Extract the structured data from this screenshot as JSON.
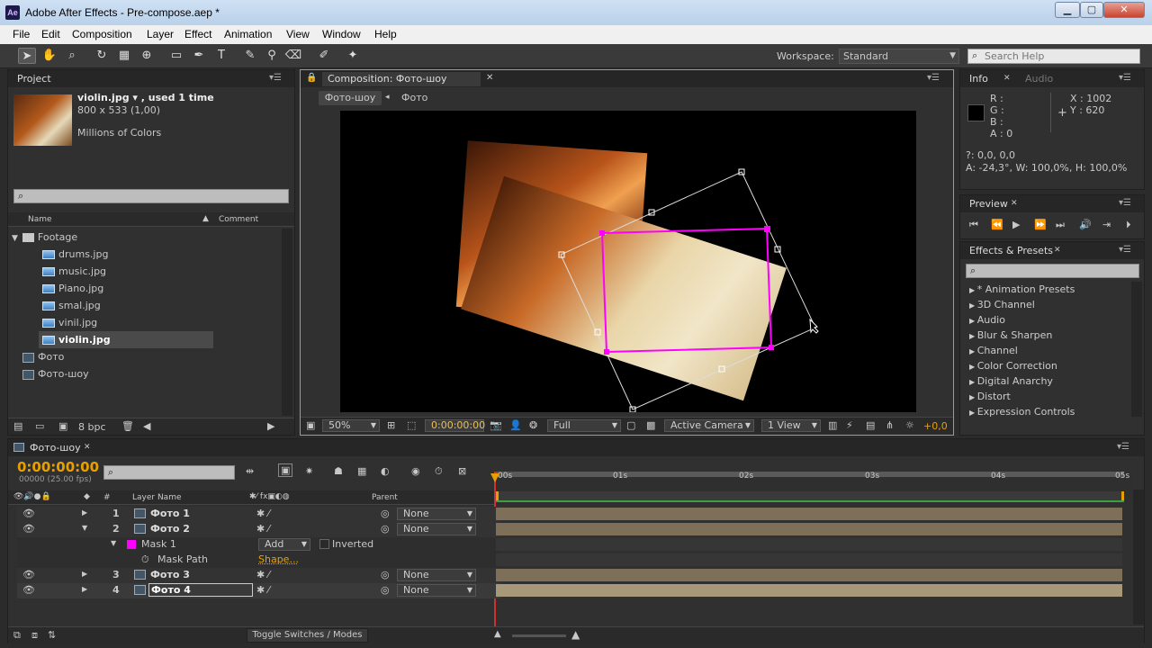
{
  "window": {
    "title": "Adobe After Effects - Pre-compose.aep *",
    "logo": "Ae",
    "min": "▁",
    "max": "▢",
    "close": "✕"
  },
  "menu": [
    "File",
    "Edit",
    "Composition",
    "Layer",
    "Effect",
    "Animation",
    "View",
    "Window",
    "Help"
  ],
  "toolbar": {
    "workspace_label": "Workspace:",
    "workspace_value": "Standard",
    "search_placeholder": "Search Help"
  },
  "project": {
    "tab": "Project",
    "file_name": "violin.jpg ▾ , used 1 time",
    "file_dims": "800 x 533 (1,00)",
    "file_colors": "Millions of Colors",
    "col_name": "Name",
    "col_comment": "Comment",
    "folder": "Footage",
    "files": [
      "drums.jpg",
      "music.jpg",
      "Piano.jpg",
      "smal.jpg",
      "vinil.jpg",
      "violin.jpg"
    ],
    "selected_file": "violin.jpg",
    "comps": [
      "Фото",
      "Фото-шоу"
    ],
    "bpc": "8 bpc"
  },
  "composition": {
    "tab": "Composition: Фото-шоу",
    "crumb_active": "Фото-шоу",
    "crumb_other": "Фото",
    "zoom": "50%",
    "timecode": "0:00:00:00",
    "resolution": "Full",
    "camera": "Active Camera",
    "views": "1 View",
    "exposure": "+0,0"
  },
  "info": {
    "tab": "Info",
    "tab2": "Audio",
    "r": "R :",
    "g": "G :",
    "b": "B :",
    "a": "A : 0",
    "x": "X : 1002",
    "y": "Y : 620",
    "line1": "?: 0,0, 0,0",
    "line2": "A: -24,3°, W: 100,0%, H: 100,0%"
  },
  "preview": {
    "tab": "Preview"
  },
  "effects": {
    "tab": "Effects & Presets",
    "items": [
      "* Animation Presets",
      "3D Channel",
      "Audio",
      "Blur & Sharpen",
      "Channel",
      "Color Correction",
      "Digital Anarchy",
      "Distort",
      "Expression Controls"
    ]
  },
  "timeline": {
    "tab": "Фото-шоу",
    "timecode": "0:00:00:00",
    "fps": "00000 (25.00 fps)",
    "col_num": "#",
    "col_layer": "Layer Name",
    "col_parent": "Parent",
    "ticks": [
      "00s",
      "01s",
      "02s",
      "03s",
      "04s",
      "05s"
    ],
    "layers": [
      {
        "num": "1",
        "name": "Фото 1",
        "parent": "None"
      },
      {
        "num": "2",
        "name": "Фото 2",
        "parent": "None"
      },
      {
        "num": "3",
        "name": "Фото 3",
        "parent": "None"
      },
      {
        "num": "4",
        "name": "Фото 4",
        "parent": "None"
      }
    ],
    "mask": {
      "name": "Mask 1",
      "mode": "Add",
      "inverted": "Inverted",
      "path_label": "Mask Path",
      "path_value": "Shape..."
    },
    "toggle": "Toggle Switches / Modes"
  },
  "colors": {
    "accent": "#e8a000",
    "mask": "#ff00ff"
  }
}
